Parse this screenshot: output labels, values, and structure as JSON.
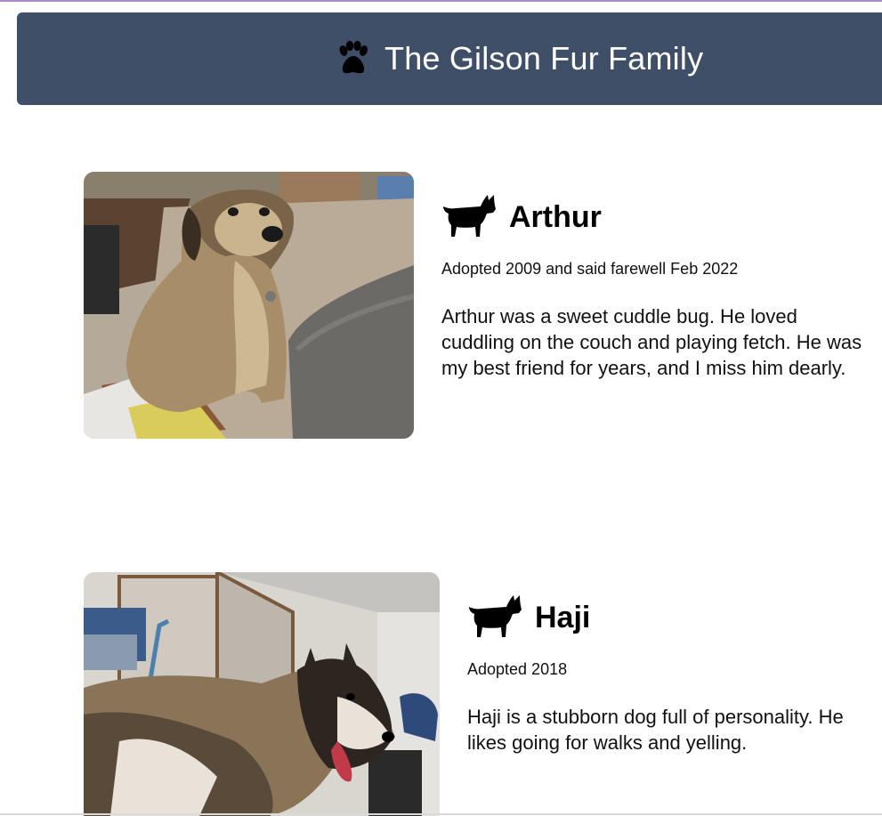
{
  "header": {
    "title": "The Gilson Fur Family",
    "icon": "paw-icon",
    "background": "#3f4f68"
  },
  "pets": [
    {
      "name": "Arthur",
      "icon": "dog-silhouette-icon",
      "date": "Adopted 2009 and said farewell Feb 2022",
      "description": "Arthur was a sweet cuddle bug. He loved cuddling on the couch and playing fetch. He was my best friend for years, and I miss him dearly."
    },
    {
      "name": "Haji",
      "icon": "dog-silhouette-icon",
      "date": "Adopted 2018",
      "description": "Haji is a stubborn dog full of personality. He likes going for walks and yelling."
    }
  ]
}
